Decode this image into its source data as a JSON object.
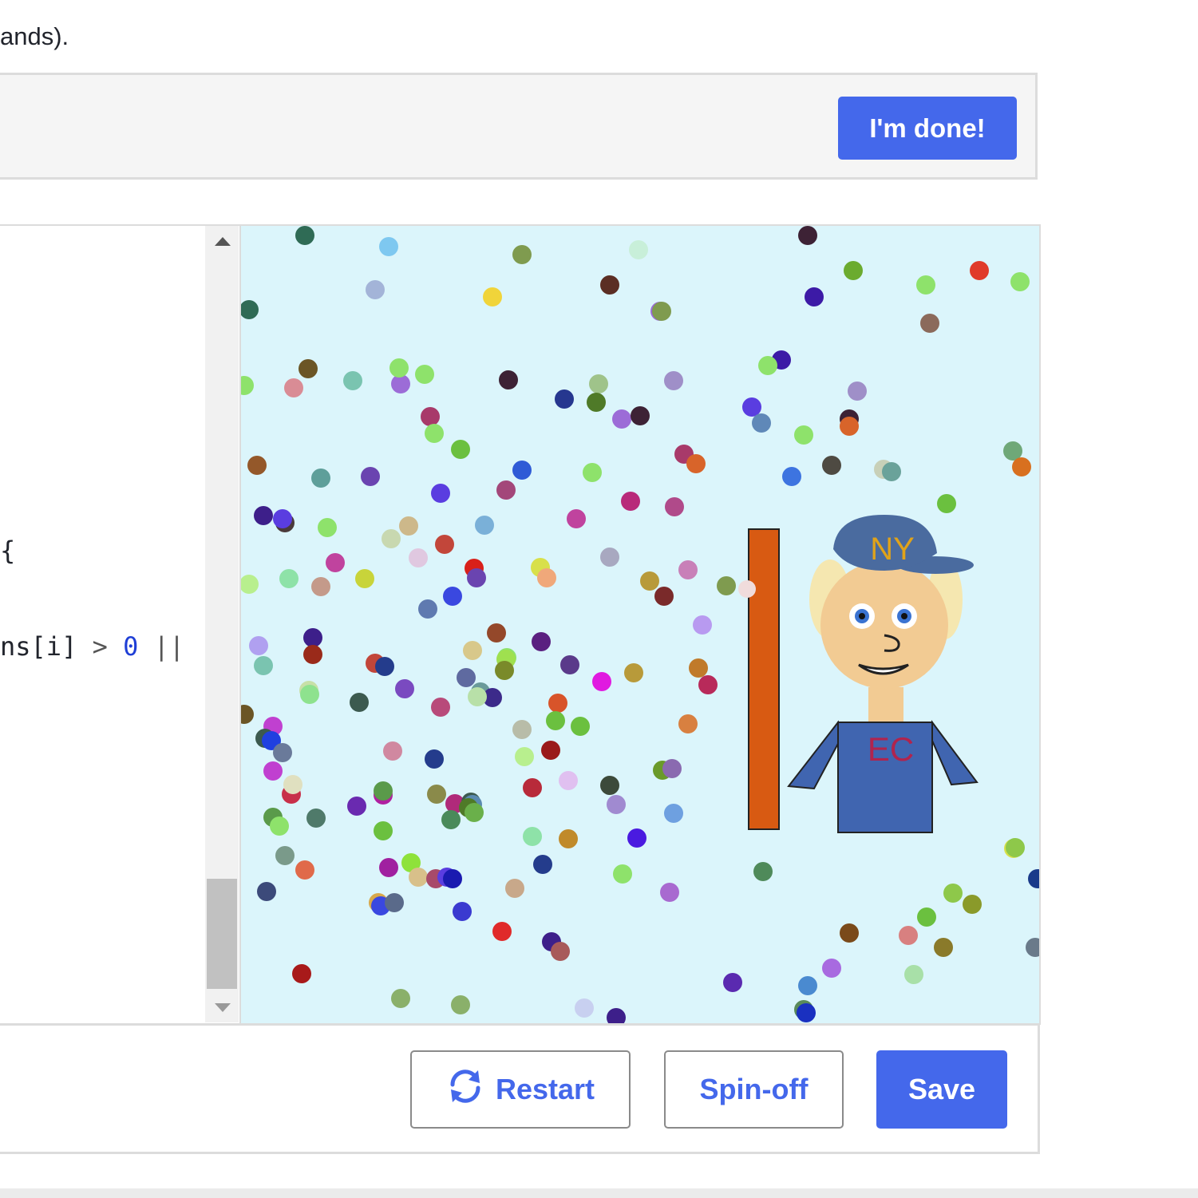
{
  "intro": {
    "text": "ands)."
  },
  "done_bar": {
    "button_label": "I'm done!"
  },
  "editor": {
    "line1": "{",
    "line2_text": "ns[i]",
    "line2_op": ">",
    "line2_num": "0",
    "line2_or": "||"
  },
  "canvas": {
    "background": "#dbf5fb",
    "cap_text": "NY",
    "shirt_text": "EC",
    "cap_color": "#4a6b9f",
    "cap_text_color": "#e0a31a",
    "shirt_color": "#4065b0",
    "shirt_text_color": "#b0244e",
    "bar_color": "#d85a12",
    "skin_color": "#f2cb93",
    "hair_color": "#f5e7b0"
  },
  "toolbar": {
    "restart_label": "Restart",
    "spinoff_label": "Spin-off",
    "save_label": "Save",
    "accent": "#4468eb"
  }
}
